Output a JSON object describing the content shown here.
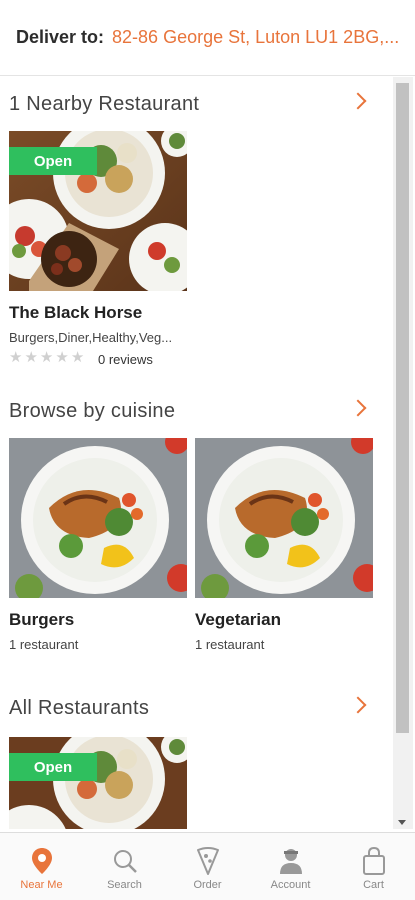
{
  "header": {
    "deliver_label": "Deliver to:",
    "address": "82-86 George St, Luton LU1 2BG,..."
  },
  "nearby": {
    "title": "1 Nearby Restaurant",
    "restaurant": {
      "badge": "Open",
      "name": "The Black Horse",
      "cuisines": "Burgers,Diner,Healthy,Veg...",
      "rating": 0,
      "reviews": "0 reviews"
    }
  },
  "browse": {
    "title": "Browse by cuisine",
    "items": [
      {
        "name": "Burgers",
        "count": "1 restaurant"
      },
      {
        "name": "Vegetarian",
        "count": "1 restaurant"
      }
    ]
  },
  "all": {
    "title": "All Restaurants",
    "restaurant": {
      "badge": "Open"
    }
  },
  "nav": {
    "items": [
      {
        "label": "Near Me",
        "icon": "location-pin-icon",
        "active": true
      },
      {
        "label": "Search",
        "icon": "search-icon",
        "active": false
      },
      {
        "label": "Order",
        "icon": "pizza-slice-icon",
        "active": false
      },
      {
        "label": "Account",
        "icon": "user-icon",
        "active": false
      },
      {
        "label": "Cart",
        "icon": "shopping-bag-icon",
        "active": false
      }
    ]
  },
  "colors": {
    "accent": "#e8743b",
    "open_badge": "#2fbf5e"
  }
}
